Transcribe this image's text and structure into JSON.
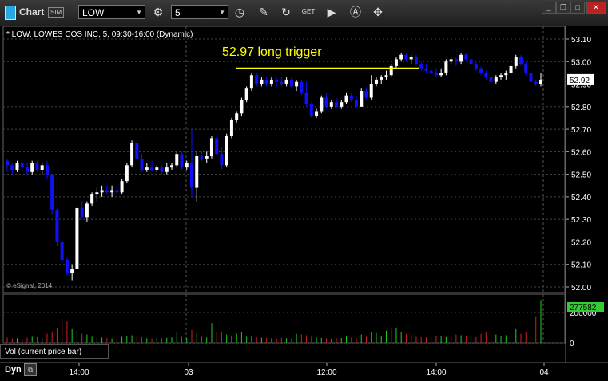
{
  "toolbar": {
    "app_title": "Chart",
    "sim_badge": "SIM",
    "symbol": "LOW",
    "interval": "5",
    "icons": [
      "settings-icon",
      "clock-icon",
      "pencil-icon",
      "draw-icon",
      "get-icon",
      "play-icon",
      "text-icon",
      "pointer-icon"
    ]
  },
  "header": {
    "description": "* LOW, LOWES COS INC, 5, 09:30-16:00 (Dynamic)"
  },
  "annotation": {
    "text": "52.97 long trigger",
    "price": 52.97,
    "color": "#ffff00"
  },
  "price_axis": {
    "ticks": [
      "53.10",
      "53.00",
      "52.90",
      "52.80",
      "52.70",
      "52.60",
      "52.50",
      "52.40",
      "52.30",
      "52.20",
      "52.10",
      "52.00"
    ],
    "last_price": "52.92"
  },
  "time_axis": {
    "labels": [
      "14:00",
      "03",
      "12:00",
      "14:00",
      "04"
    ]
  },
  "volume": {
    "label": "Vol (current price bar)",
    "last_value": "277582",
    "ticks": [
      "200000",
      "0"
    ]
  },
  "footer": {
    "mode": "Dyn"
  },
  "copyright": "© eSignal, 2014",
  "colors": {
    "up": "#ffffff",
    "down": "#1010ff",
    "vol_up": "#22cc22",
    "vol_down": "#cc2222",
    "grid": "#444444",
    "last_price_badge": "#33cc33"
  },
  "chart_data": {
    "type": "candlestick",
    "ylim": [
      52.0,
      53.1
    ],
    "candles": [
      [
        52.56,
        52.57,
        52.51,
        52.54
      ],
      [
        52.54,
        52.55,
        52.5,
        52.52
      ],
      [
        52.52,
        52.56,
        52.51,
        52.55
      ],
      [
        52.55,
        52.56,
        52.52,
        52.53
      ],
      [
        52.53,
        52.55,
        52.5,
        52.51
      ],
      [
        52.51,
        52.56,
        52.5,
        52.55
      ],
      [
        52.55,
        52.56,
        52.51,
        52.52
      ],
      [
        52.52,
        52.55,
        52.5,
        52.54
      ],
      [
        52.54,
        52.56,
        52.48,
        52.5
      ],
      [
        52.5,
        52.5,
        52.32,
        52.34
      ],
      [
        52.34,
        52.35,
        52.18,
        52.2
      ],
      [
        52.2,
        52.22,
        52.1,
        52.12
      ],
      [
        52.12,
        52.13,
        52.05,
        52.06
      ],
      [
        52.06,
        52.1,
        52.03,
        52.08
      ],
      [
        52.08,
        52.36,
        52.08,
        52.35
      ],
      [
        52.35,
        52.38,
        52.3,
        52.31
      ],
      [
        52.31,
        52.38,
        52.29,
        52.37
      ],
      [
        52.37,
        52.42,
        52.36,
        52.41
      ],
      [
        52.41,
        52.44,
        52.38,
        52.42
      ],
      [
        52.42,
        52.45,
        52.4,
        52.43
      ],
      [
        52.43,
        52.45,
        52.41,
        52.42
      ],
      [
        52.42,
        52.45,
        52.4,
        52.43
      ],
      [
        52.43,
        52.45,
        52.41,
        52.42
      ],
      [
        52.42,
        52.48,
        52.41,
        52.47
      ],
      [
        52.47,
        52.55,
        52.46,
        52.54
      ],
      [
        52.54,
        52.65,
        52.53,
        52.64
      ],
      [
        52.64,
        52.65,
        52.56,
        52.57
      ],
      [
        52.57,
        52.59,
        52.51,
        52.52
      ],
      [
        52.52,
        52.55,
        52.51,
        52.53
      ],
      [
        52.53,
        52.56,
        52.51,
        52.52
      ],
      [
        52.52,
        52.54,
        52.51,
        52.53
      ],
      [
        52.53,
        52.54,
        52.5,
        52.51
      ],
      [
        52.51,
        52.55,
        52.5,
        52.53
      ],
      [
        52.53,
        52.55,
        52.52,
        52.54
      ],
      [
        52.54,
        52.6,
        52.53,
        52.59
      ],
      [
        52.59,
        52.6,
        52.52,
        52.53
      ],
      [
        52.53,
        52.56,
        52.52,
        52.55
      ],
      [
        52.55,
        52.7,
        52.4,
        52.44
      ],
      [
        52.44,
        52.6,
        52.38,
        52.58
      ],
      [
        52.58,
        52.6,
        52.56,
        52.57
      ],
      [
        52.57,
        52.6,
        52.55,
        52.58
      ],
      [
        52.58,
        52.67,
        52.57,
        52.66
      ],
      [
        52.66,
        52.67,
        52.58,
        52.59
      ],
      [
        52.59,
        52.62,
        52.52,
        52.54
      ],
      [
        52.54,
        52.68,
        52.53,
        52.67
      ],
      [
        52.67,
        52.75,
        52.66,
        52.74
      ],
      [
        52.74,
        52.78,
        52.73,
        52.77
      ],
      [
        52.77,
        52.84,
        52.76,
        52.83
      ],
      [
        52.83,
        52.89,
        52.82,
        52.88
      ],
      [
        52.88,
        52.95,
        52.87,
        52.94
      ],
      [
        52.94,
        52.95,
        52.89,
        52.9
      ],
      [
        52.9,
        52.93,
        52.89,
        52.92
      ],
      [
        52.92,
        52.93,
        52.89,
        52.9
      ],
      [
        52.9,
        52.93,
        52.89,
        52.92
      ],
      [
        52.92,
        52.93,
        52.89,
        52.91
      ],
      [
        52.91,
        52.93,
        52.89,
        52.9
      ],
      [
        52.9,
        52.93,
        52.89,
        52.92
      ],
      [
        52.92,
        52.93,
        52.88,
        52.89
      ],
      [
        52.89,
        52.92,
        52.87,
        52.91
      ],
      [
        52.91,
        52.92,
        52.85,
        52.86
      ],
      [
        52.86,
        52.91,
        52.8,
        52.81
      ],
      [
        52.81,
        52.82,
        52.75,
        52.76
      ],
      [
        52.76,
        52.79,
        52.75,
        52.78
      ],
      [
        52.78,
        52.85,
        52.77,
        52.84
      ],
      [
        52.84,
        52.86,
        52.79,
        52.8
      ],
      [
        52.8,
        52.83,
        52.79,
        52.82
      ],
      [
        52.82,
        52.84,
        52.79,
        52.8
      ],
      [
        52.8,
        52.83,
        52.79,
        52.82
      ],
      [
        52.82,
        52.86,
        52.81,
        52.85
      ],
      [
        52.85,
        52.86,
        52.82,
        52.83
      ],
      [
        52.83,
        52.85,
        52.79,
        52.8
      ],
      [
        52.8,
        52.88,
        52.8,
        52.87
      ],
      [
        52.87,
        52.88,
        52.83,
        52.84
      ],
      [
        52.84,
        52.94,
        52.83,
        52.9
      ],
      [
        52.9,
        52.93,
        52.89,
        52.92
      ],
      [
        52.92,
        52.94,
        52.9,
        52.93
      ],
      [
        52.93,
        52.96,
        52.92,
        52.94
      ],
      [
        52.94,
        52.99,
        52.93,
        52.98
      ],
      [
        52.98,
        53.02,
        52.97,
        53.01
      ],
      [
        53.01,
        53.04,
        53.0,
        53.03
      ],
      [
        53.03,
        53.04,
        53.0,
        53.01
      ],
      [
        53.01,
        53.03,
        52.99,
        53.02
      ],
      [
        53.02,
        53.03,
        52.98,
        52.99
      ],
      [
        52.99,
        53.0,
        52.96,
        52.97
      ],
      [
        52.97,
        52.99,
        52.95,
        52.96
      ],
      [
        52.96,
        52.98,
        52.94,
        52.95
      ],
      [
        52.95,
        52.97,
        52.93,
        52.94
      ],
      [
        52.94,
        52.97,
        52.93,
        52.95
      ],
      [
        52.95,
        53.01,
        52.94,
        53.0
      ],
      [
        53.0,
        53.02,
        52.99,
        53.01
      ],
      [
        53.01,
        53.02,
        52.98,
        53.0
      ],
      [
        53.0,
        53.04,
        52.99,
        53.03
      ],
      [
        53.03,
        53.04,
        53.0,
        53.01
      ],
      [
        53.01,
        53.03,
        52.98,
        52.99
      ],
      [
        52.99,
        53.0,
        52.96,
        52.97
      ],
      [
        52.97,
        52.98,
        52.94,
        52.95
      ],
      [
        52.95,
        52.96,
        52.92,
        52.93
      ],
      [
        52.93,
        52.94,
        52.9,
        52.91
      ],
      [
        52.91,
        52.94,
        52.9,
        52.93
      ],
      [
        52.93,
        52.95,
        52.92,
        52.94
      ],
      [
        52.94,
        52.96,
        52.92,
        52.95
      ],
      [
        52.95,
        52.99,
        52.94,
        52.98
      ],
      [
        52.98,
        53.03,
        52.97,
        53.02
      ],
      [
        53.02,
        53.03,
        52.98,
        52.99
      ],
      [
        52.99,
        53.0,
        52.94,
        52.95
      ],
      [
        52.95,
        52.96,
        52.9,
        52.91
      ],
      [
        52.91,
        52.92,
        52.89,
        52.9
      ],
      [
        52.9,
        52.95,
        52.89,
        52.92
      ]
    ],
    "volume": [
      35000,
      28000,
      30000,
      26000,
      34000,
      40000,
      38000,
      30000,
      60000,
      75000,
      95000,
      160000,
      140000,
      90000,
      85000,
      60000,
      55000,
      40000,
      30000,
      35000,
      32000,
      28000,
      30000,
      40000,
      45000,
      50000,
      42000,
      38000,
      30000,
      28000,
      32000,
      29000,
      33000,
      36000,
      70000,
      40000,
      30000,
      85000,
      60000,
      40000,
      35000,
      130000,
      75000,
      70000,
      55000,
      48000,
      62000,
      70000,
      40000,
      45000,
      38000,
      34000,
      32000,
      30000,
      28000,
      33000,
      30000,
      29000,
      60000,
      55000,
      50000,
      40000,
      36000,
      32000,
      30000,
      28000,
      30000,
      32000,
      45000,
      34000,
      30000,
      55000,
      40000,
      70000,
      65000,
      45000,
      80000,
      100000,
      95000,
      70000,
      60000,
      55000,
      40000,
      38000,
      36000,
      34000,
      45000,
      42000,
      38000,
      40000,
      55000,
      50000,
      45000,
      40000,
      38000,
      60000,
      70000,
      80000,
      55000,
      45000,
      50000,
      70000,
      90000,
      60000,
      70000,
      110000,
      170000,
      277582
    ]
  }
}
